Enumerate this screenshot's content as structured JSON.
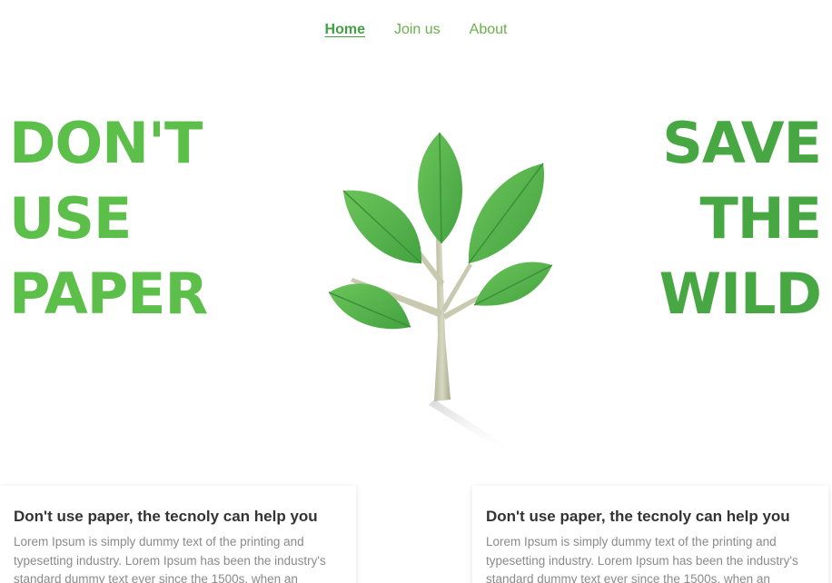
{
  "nav": {
    "items": [
      {
        "label": "Home",
        "active": true
      },
      {
        "label": "Join us",
        "active": false
      },
      {
        "label": "About",
        "active": false
      }
    ]
  },
  "hero": {
    "left_lines": [
      "DON'T",
      "USE",
      "PAPER"
    ],
    "right_lines": [
      "SAVE",
      "THE",
      "WILD"
    ],
    "image_icon": "tree-icon",
    "colors": {
      "left": "#5bbf4a",
      "right": "#47a843",
      "nav": "#6ab04c"
    }
  },
  "cards": [
    {
      "title": "Don't use paper, the tecnoly can help you",
      "text": "Lorem Ipsum is simply dummy text of the printing and typesetting industry. Lorem Ipsum has been the industry's standard dummy text ever since the 1500s, when an"
    },
    {
      "title": "Don't use paper, the tecnoly can help you",
      "text": "Lorem Ipsum is simply dummy text of the printing and typesetting industry. Lorem Ipsum has been the industry's standard dummy text ever since the 1500s, when an"
    }
  ]
}
